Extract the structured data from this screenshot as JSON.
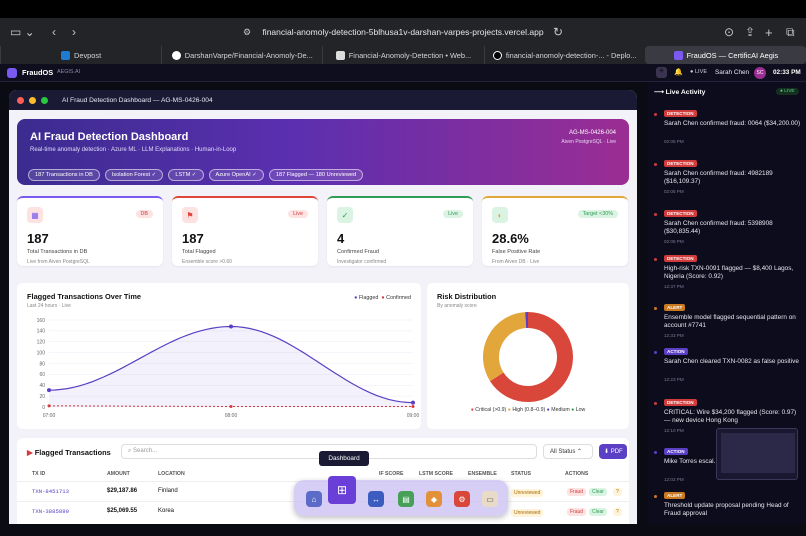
{
  "browser": {
    "url": "financial-anomoly-detection-5blhusa1v-darshan-varpes-projects.vercel.app",
    "tabs": [
      {
        "label": "Devpost"
      },
      {
        "label": "DarshanVarpe/Financial-Anomoly-De..."
      },
      {
        "label": "Financial-Anomoly-Detection • Web..."
      },
      {
        "label": "financial-anomoly-detection-... - Deplo..."
      },
      {
        "label": "FraudOS — CertificAI Aegis"
      }
    ]
  },
  "app": {
    "brand": "FraudOS",
    "brand_sub": "AEGIS.AI",
    "live": "LIVE",
    "user": "Sarah Chen",
    "user_initials": "SC",
    "time": "02:33 PM"
  },
  "window": {
    "title": "AI Fraud Detection Dashboard — AG-MS-0426-004"
  },
  "hero": {
    "title": "AI Fraud Detection Dashboard",
    "subtitle": "Real-time anomaly detection · Azure ML · LLM Explanations · Human-in-Loop",
    "id": "AG-MS-0426-004",
    "source": "Aiven PostgreSQL · Live",
    "pills": [
      "187 Transactions in DB",
      "Isolation Forest ✓",
      "LSTM ✓",
      "Azure OpenAI ✓",
      "187 Flagged — 180 Unreviewed"
    ]
  },
  "cards": [
    {
      "icon": "grid-icon",
      "glyph": "▦",
      "badge": "DB",
      "value": "187",
      "label": "Total Transactions in DB",
      "sub": "Live from Aiven PostgreSQL",
      "accent": "#7a5af0",
      "badge_bg": "#fde2e2",
      "badge_fg": "#d23b3b"
    },
    {
      "icon": "flag-icon",
      "glyph": "⚑",
      "badge": "Live",
      "value": "187",
      "label": "Total Flagged",
      "sub": "Ensemble score >0.60",
      "accent": "#e0453a",
      "badge_bg": "#fde2e2",
      "badge_fg": "#d23b3b"
    },
    {
      "icon": "check-icon",
      "glyph": "✓",
      "badge": "Live",
      "value": "4",
      "label": "Confirmed Fraud",
      "sub": "Investigator confirmed",
      "accent": "#2e9e56",
      "badge_bg": "#daf3e2",
      "badge_fg": "#2e9e56"
    },
    {
      "icon": "contrast-icon",
      "glyph": "◐",
      "badge": "Target <30%",
      "value": "28.6%",
      "label": "False Positive Rate",
      "sub": "From Aiven DB · Live",
      "accent": "#e2a63a",
      "badge_bg": "#daf3e2",
      "badge_fg": "#2e9e56"
    }
  ],
  "line_chart": {
    "title": "Flagged Transactions Over Time",
    "subtitle": "Last 24 hours · Live",
    "legend": [
      "Flagged",
      "Confirmed"
    ]
  },
  "donut": {
    "title": "Risk Distribution",
    "subtitle": "By anomaly score",
    "legend": [
      "Critical (>0.9)",
      "High (0.8–0.9)",
      "Medium",
      "Low"
    ]
  },
  "chart_data": [
    {
      "type": "area",
      "title": "Flagged Transactions Over Time",
      "subtitle": "Last 24 hours · Live",
      "x_ticks": [
        "07:00",
        "08:00",
        "09:00"
      ],
      "ylim": [
        0,
        160
      ],
      "y_ticks": [
        0,
        20,
        40,
        60,
        80,
        100,
        120,
        140,
        160
      ],
      "grid": true,
      "legend": "top-right",
      "series": [
        {
          "name": "Flagged",
          "color": "#5b3fc4",
          "x": [
            0,
            1,
            2
          ],
          "values": [
            31,
            148,
            8
          ]
        },
        {
          "name": "Confirmed",
          "color": "#d23b3b",
          "x": [
            0,
            1,
            2
          ],
          "values": [
            2,
            1,
            1
          ]
        }
      ]
    },
    {
      "type": "pie",
      "title": "Risk Distribution",
      "subtitle": "By anomaly score",
      "legend": "bottom",
      "slices": [
        {
          "label": "Critical (>0.9)",
          "value": 66,
          "color": "#d9473b"
        },
        {
          "label": "High (0.8–0.9)",
          "value": 33,
          "color": "#e2a63a"
        },
        {
          "label": "Medium",
          "value": 1,
          "color": "#5b3fc4"
        },
        {
          "label": "Low",
          "value": 0,
          "color": "#2e9e56"
        }
      ]
    }
  ],
  "flagged": {
    "title": "Flagged Transactions",
    "search_placeholder": "Search...",
    "status_filter": "All Status",
    "pdf_label": "⬇ PDF",
    "tooltip": "Dashboard",
    "columns": [
      "TX ID",
      "AMOUNT",
      "LOCATION",
      "IF SCORE",
      "LSTM SCORE",
      "ENSEMBLE",
      "STATUS",
      "ACTIONS"
    ],
    "rows": [
      {
        "id": "TXN-8451713",
        "amount": "$29,187.86",
        "location": "Finland",
        "status": "Unreviewed"
      },
      {
        "id": "TXN-3885890",
        "amount": "$25,069.55",
        "location": "Korea",
        "status": "Unreviewed"
      }
    ],
    "actions": [
      "Fraud",
      "Clear",
      "?"
    ]
  },
  "side": {
    "title": "Live Activity",
    "live": "LIVE",
    "items": [
      {
        "type": "DETECTION",
        "color": "#d23b3b",
        "text": "Sarah Chen confirmed fraud: 0064 ($34,200.00)",
        "time": "02:05 PM"
      },
      {
        "type": "DETECTION",
        "color": "#d23b3b",
        "text": "Sarah Chen confirmed fraud: 4982189 ($16,109.37)",
        "time": "02:05 PM"
      },
      {
        "type": "DETECTION",
        "color": "#d23b3b",
        "text": "Sarah Chen confirmed fraud: 5398908 ($30,835.44)",
        "time": "02:05 PM"
      },
      {
        "type": "DETECTION",
        "color": "#d23b3b",
        "text": "High-risk TXN-0091 flagged — $8,400 Lagos, Nigeria (Score: 0.92)",
        "time": "12:37 PM"
      },
      {
        "type": "ALERT",
        "color": "#c9791f",
        "text": "Ensemble model flagged sequential pattern on account #7741",
        "time": "12:33 PM"
      },
      {
        "type": "ACTION",
        "color": "#5b3fc4",
        "text": "Sarah Chen cleared TXN-0082 as false positive",
        "time": "12:23 PM"
      },
      {
        "type": "DETECTION",
        "color": "#d23b3b",
        "text": "CRITICAL: Wire $34,200 flagged (Score: 0.97) — new device Hong Kong",
        "time": "12:10 PM"
      },
      {
        "type": "ACTION",
        "color": "#5b3fc4",
        "text": "Mike Torres escal... travel pattern cor...",
        "time": "12:02 PM"
      },
      {
        "type": "ALERT",
        "color": "#c9791f",
        "text": "Threshold update proposal pending Head of Fraud approval",
        "time": ""
      }
    ]
  }
}
